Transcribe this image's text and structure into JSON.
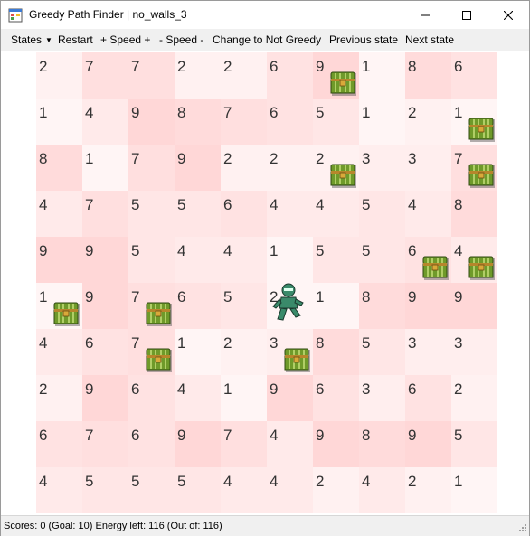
{
  "window": {
    "title": "Greedy Path Finder | no_walls_3",
    "icons": {
      "app": "app-icon",
      "minimize": "minimize-icon",
      "maximize": "maximize-icon",
      "close": "close-icon"
    }
  },
  "menu": {
    "states": "States",
    "restart": "Restart",
    "speed_up": "+ Speed +",
    "speed_down": "- Speed -",
    "change_mode": "Change to Not Greedy",
    "previous_state": "Previous state",
    "next_state": "Next state"
  },
  "grid": {
    "rows": [
      [
        2,
        7,
        7,
        2,
        2,
        6,
        9,
        1,
        8,
        6
      ],
      [
        1,
        4,
        9,
        8,
        7,
        6,
        5,
        1,
        2,
        1
      ],
      [
        8,
        1,
        7,
        9,
        2,
        2,
        2,
        3,
        3,
        7
      ],
      [
        4,
        7,
        5,
        5,
        6,
        4,
        4,
        5,
        4,
        8
      ],
      [
        9,
        9,
        5,
        4,
        4,
        1,
        5,
        5,
        6,
        4
      ],
      [
        1,
        9,
        7,
        6,
        5,
        2,
        1,
        8,
        9,
        9
      ],
      [
        4,
        6,
        7,
        1,
        2,
        3,
        8,
        5,
        3,
        3
      ],
      [
        2,
        9,
        6,
        4,
        1,
        9,
        6,
        3,
        6,
        2
      ],
      [
        6,
        7,
        6,
        9,
        7,
        4,
        9,
        8,
        9,
        5
      ],
      [
        4,
        5,
        5,
        5,
        4,
        4,
        2,
        4,
        2,
        1
      ]
    ],
    "chests": [
      [
        0,
        6
      ],
      [
        1,
        9
      ],
      [
        2,
        6
      ],
      [
        2,
        9
      ],
      [
        4,
        8
      ],
      [
        4,
        9
      ],
      [
        5,
        0
      ],
      [
        5,
        2
      ],
      [
        6,
        2
      ],
      [
        6,
        5
      ]
    ],
    "player": [
      5,
      5
    ],
    "colors": {
      "shade": "#ffb4b4",
      "visited": "#fff5f5",
      "chest": "#6f9a2a",
      "chest_band": "#b7862b",
      "player": "#3a8a6a"
    }
  },
  "status": {
    "text": "Scores: 0 (Goal: 10) Energy left: 116 (Out of: 116)"
  }
}
